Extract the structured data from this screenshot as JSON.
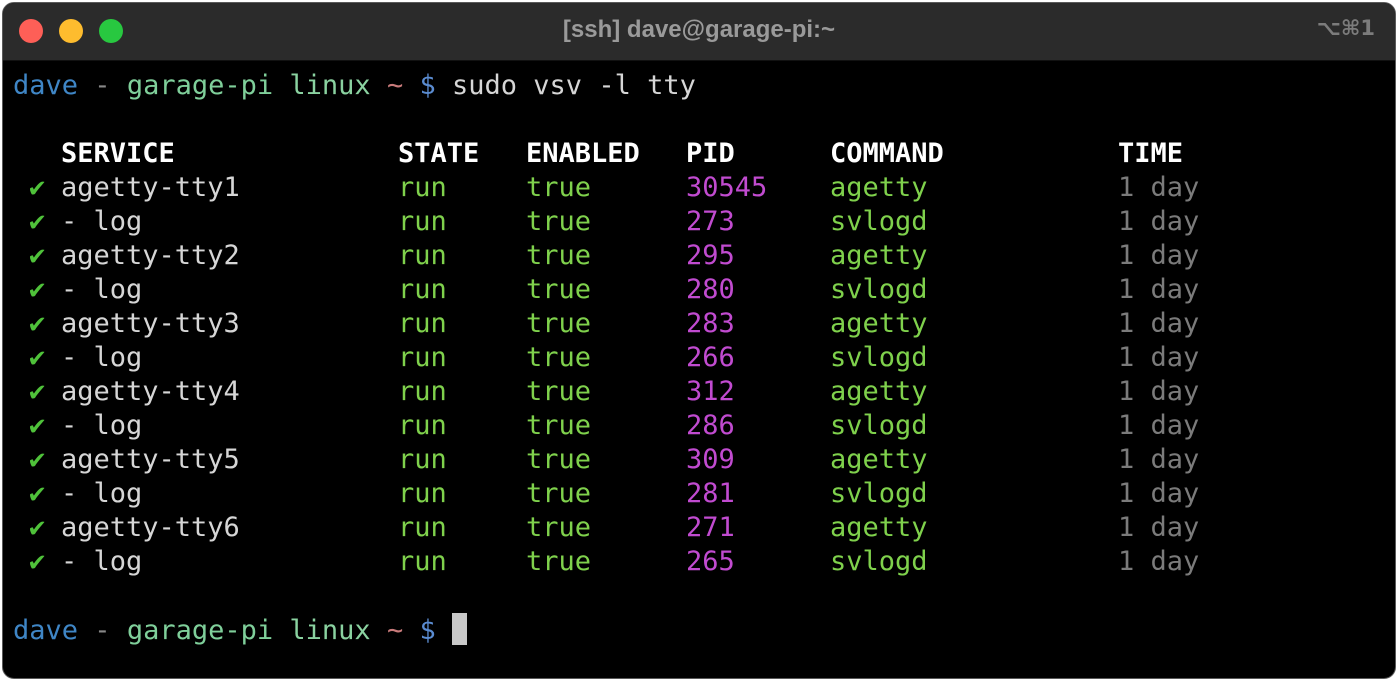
{
  "window": {
    "title": "[ssh] dave@garage-pi:~",
    "shortcut": "⌥⌘1"
  },
  "prompt": {
    "user": "dave",
    "separator": "-",
    "host": "garage-pi",
    "os": "linux",
    "cwd": "~",
    "symbol": "$"
  },
  "command": "sudo vsv -l tty",
  "table": {
    "headers": [
      "SERVICE",
      "STATE",
      "ENABLED",
      "PID",
      "COMMAND",
      "TIME"
    ],
    "rows": [
      {
        "check": "✔",
        "service": "agetty-tty1",
        "state": "run",
        "enabled": "true",
        "pid": "30545",
        "command": "agetty",
        "time": "1 day"
      },
      {
        "check": "✔",
        "service": "- log",
        "state": "run",
        "enabled": "true",
        "pid": "273",
        "command": "svlogd",
        "time": "1 day"
      },
      {
        "check": "✔",
        "service": "agetty-tty2",
        "state": "run",
        "enabled": "true",
        "pid": "295",
        "command": "agetty",
        "time": "1 day"
      },
      {
        "check": "✔",
        "service": "- log",
        "state": "run",
        "enabled": "true",
        "pid": "280",
        "command": "svlogd",
        "time": "1 day"
      },
      {
        "check": "✔",
        "service": "agetty-tty3",
        "state": "run",
        "enabled": "true",
        "pid": "283",
        "command": "agetty",
        "time": "1 day"
      },
      {
        "check": "✔",
        "service": "- log",
        "state": "run",
        "enabled": "true",
        "pid": "266",
        "command": "svlogd",
        "time": "1 day"
      },
      {
        "check": "✔",
        "service": "agetty-tty4",
        "state": "run",
        "enabled": "true",
        "pid": "312",
        "command": "agetty",
        "time": "1 day"
      },
      {
        "check": "✔",
        "service": "- log",
        "state": "run",
        "enabled": "true",
        "pid": "286",
        "command": "svlogd",
        "time": "1 day"
      },
      {
        "check": "✔",
        "service": "agetty-tty5",
        "state": "run",
        "enabled": "true",
        "pid": "309",
        "command": "agetty",
        "time": "1 day"
      },
      {
        "check": "✔",
        "service": "- log",
        "state": "run",
        "enabled": "true",
        "pid": "281",
        "command": "svlogd",
        "time": "1 day"
      },
      {
        "check": "✔",
        "service": "agetty-tty6",
        "state": "run",
        "enabled": "true",
        "pid": "271",
        "command": "agetty",
        "time": "1 day"
      },
      {
        "check": "✔",
        "service": "- log",
        "state": "run",
        "enabled": "true",
        "pid": "265",
        "command": "svlogd",
        "time": "1 day"
      }
    ]
  },
  "colors": {
    "background": "#000000",
    "titlebar": "#2b2b2b",
    "green": "#7fd14c",
    "magenta": "#c14bd0",
    "gray": "#7b7b7b",
    "user": "#3f86c6"
  }
}
